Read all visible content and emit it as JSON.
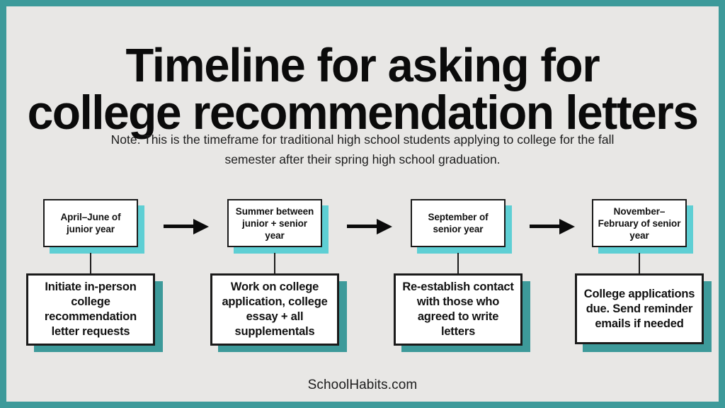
{
  "poster": {
    "frame_color": "#3d9a9a",
    "background_color": "#e8e7e5",
    "title_line1": "Timeline for asking for",
    "title_line2": "college recommendation letters",
    "note_line1": "Note: This is the timeframe for traditional high school students applying to college for the fall",
    "note_line2": "semester after their spring high school graduation.",
    "footer": "SchoolHabits.com"
  },
  "colors": {
    "accent_teal": "#3d9a9a",
    "accent_cyan": "#5ecfd4",
    "ink": "#111111",
    "surface": "#ffffff"
  },
  "timeline": {
    "arrow_label": "next step arrow",
    "steps": [
      {
        "date": "April–June of junior year",
        "action": "Initiate in-person college recommendation letter requests"
      },
      {
        "date": "Summer between junior + senior year",
        "action": "Work on college application, college essay + all supplementals"
      },
      {
        "date": "September of senior year",
        "action": "Re-establish contact with those who agreed to write letters"
      },
      {
        "date": "November–February of senior year",
        "action": "College applications due. Send reminder emails if needed"
      }
    ]
  }
}
